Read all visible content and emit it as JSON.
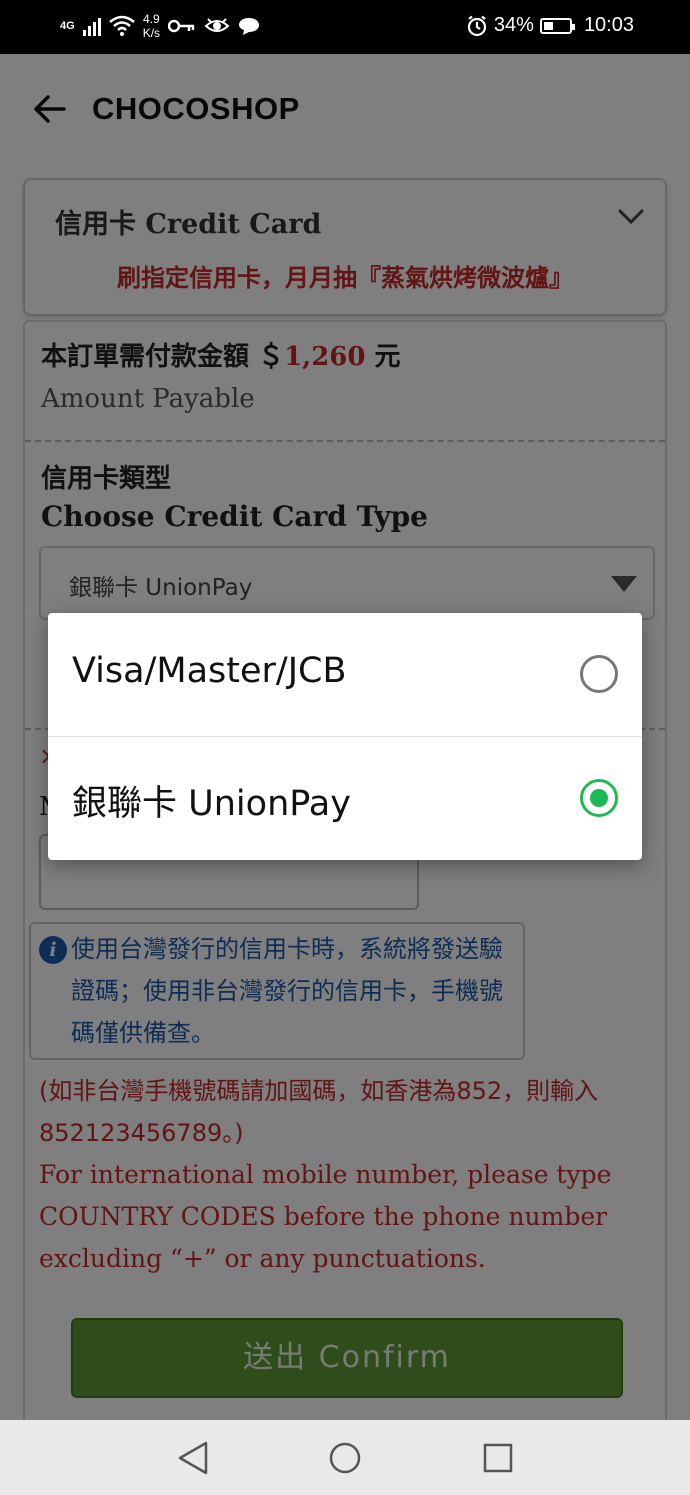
{
  "status_bar": {
    "network": "4G",
    "speed_value": "4.9",
    "speed_unit": "K/s",
    "battery": "34%",
    "time": "10:03"
  },
  "app_bar": {
    "title": "CHOCOSHOP"
  },
  "payment_method": {
    "title": "信用卡 Credit Card",
    "promo": "刷指定信用卡，月月抽『蒸氣烘烤微波爐』"
  },
  "order": {
    "amount_label": "本訂單需付款金額 ＄",
    "amount_value": "1,260",
    "amount_unit": " 元",
    "amount_en": "Amount Payable"
  },
  "card_type": {
    "label_zh": "信用卡類型",
    "label_en": "Choose Credit Card Type",
    "selected": "銀聯卡 UnionPay"
  },
  "mobile": {
    "required_mark": "×",
    "label_partial": "M"
  },
  "notice": "使用台灣發行的信用卡時，系統將發送驗證碼；使用非台灣發行的信用卡，手機號碼僅供備查。",
  "intl_note_zh": "(如非台灣手機號碼請加國碼，如香港為852，則輸入852123456789。)",
  "intl_note_en": "For international mobile number, please type COUNTRY CODES before the phone number excluding “+” or any punctuations.",
  "confirm_label": "送出 Confirm",
  "dialog": {
    "options": [
      {
        "label": "Visa/Master/JCB",
        "selected": false
      },
      {
        "label": "銀聯卡 UnionPay",
        "selected": true
      }
    ]
  },
  "colors": {
    "accent_green": "#1db954",
    "alert_red": "#c62828",
    "button_green": "#5f9a35",
    "info_blue": "#1e5aa8"
  }
}
